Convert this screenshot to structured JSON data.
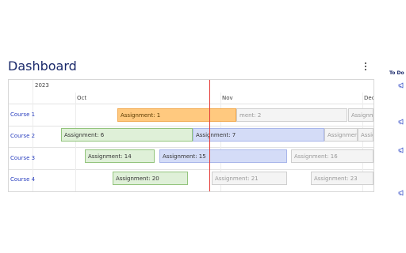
{
  "header": {
    "title": "Dashboard"
  },
  "timeline": {
    "year": "2023",
    "months": [
      "Oct",
      "Nov",
      "Dec"
    ]
  },
  "rows": [
    {
      "label": "Course 1"
    },
    {
      "label": "Course 2"
    },
    {
      "label": "Course 3"
    },
    {
      "label": "Course 4"
    }
  ],
  "assignments": [
    {
      "label": "Assignment: 1",
      "status": "current"
    },
    {
      "label": "ment: 2",
      "status": "upcoming"
    },
    {
      "label": "Assignm",
      "status": "upcoming"
    },
    {
      "label": "Assignment: 6",
      "status": "done"
    },
    {
      "label": "Assignment: 7",
      "status": "active"
    },
    {
      "label": "Assignment:",
      "status": "upcoming"
    },
    {
      "label": "Assig",
      "status": "upcoming"
    },
    {
      "label": "Assignment: 14",
      "status": "done"
    },
    {
      "label": "Assignment: 15",
      "status": "active"
    },
    {
      "label": "Assignment: 16",
      "status": "upcoming"
    },
    {
      "label": "Assignment: 20",
      "status": "done"
    },
    {
      "label": "Assignment: 21",
      "status": "upcoming"
    },
    {
      "label": "Assignment: 23",
      "status": "upcoming"
    }
  ],
  "todo": {
    "title": "To Do"
  },
  "icons": {
    "menu": "kebab-menu-icon",
    "todo_item": "megaphone-icon"
  },
  "colors": {
    "accent": "#1b2a6b",
    "today_line": "#e53935",
    "current": "#ffc97f",
    "done": "#dff0d8",
    "active": "#d4dcf7",
    "upcoming": "#f4f4f4"
  }
}
